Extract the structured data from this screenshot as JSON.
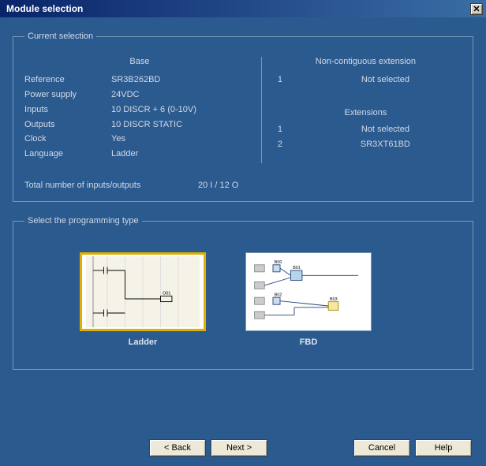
{
  "window": {
    "title": "Module selection"
  },
  "current_selection": {
    "legend": "Current selection",
    "base_heading": "Base",
    "rows": {
      "reference_label": "Reference",
      "reference_value": "SR3B262BD",
      "power_label": "Power supply",
      "power_value": "24VDC",
      "inputs_label": "Inputs",
      "inputs_value": "10 DISCR + 6 (0-10V)",
      "outputs_label": "Outputs",
      "outputs_value": "10 DISCR STATIC",
      "clock_label": "Clock",
      "clock_value": "Yes",
      "language_label": "Language",
      "language_value": "Ladder"
    },
    "noncontig_heading": "Non-contiguous extension",
    "noncontig": {
      "idx1": "1",
      "val1": "Not selected"
    },
    "ext_heading": "Extensions",
    "ext": {
      "idx1": "1",
      "val1": "Not selected",
      "idx2": "2",
      "val2": "SR3XT61BD"
    },
    "total_label": "Total number of inputs/outputs",
    "total_value": "20 I / 12 O"
  },
  "programming": {
    "legend": "Select the programming type",
    "ladder_label": "Ladder",
    "fbd_label": "FBD"
  },
  "buttons": {
    "back": "< Back",
    "next": "Next >",
    "cancel": "Cancel",
    "help": "Help"
  }
}
